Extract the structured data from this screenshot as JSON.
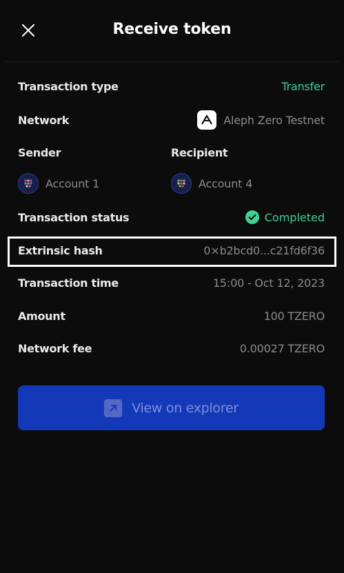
{
  "header": {
    "title": "Receive token",
    "close_icon": "close-icon"
  },
  "details": {
    "transaction_type": {
      "label": "Transaction type",
      "value": "Transfer"
    },
    "network": {
      "label": "Network",
      "value": "Aleph Zero Testnet",
      "icon": "aleph-zero-logo-icon"
    },
    "sender": {
      "label": "Sender",
      "account": "Account 1"
    },
    "recipient": {
      "label": "Recipient",
      "account": "Account 4"
    },
    "status": {
      "label": "Transaction status",
      "value": "Completed",
      "icon": "check-circle-icon"
    },
    "extrinsic_hash": {
      "label": "Extrinsic hash",
      "value": "0×b2bcd0...c21fd6f36"
    },
    "transaction_time": {
      "label": "Transaction time",
      "value": "15:00 - Oct 12, 2023"
    },
    "amount": {
      "label": "Amount",
      "value": "100 TZERO"
    },
    "network_fee": {
      "label": "Network fee",
      "value": "0.00027 TZERO"
    }
  },
  "actions": {
    "view_explorer_label": "View on explorer",
    "view_explorer_icon": "external-link-icon"
  },
  "colors": {
    "background": "#0c0c0d",
    "accent_green": "#43cf96",
    "button_blue": "#1439b8",
    "muted_text": "#8b8b8f"
  }
}
